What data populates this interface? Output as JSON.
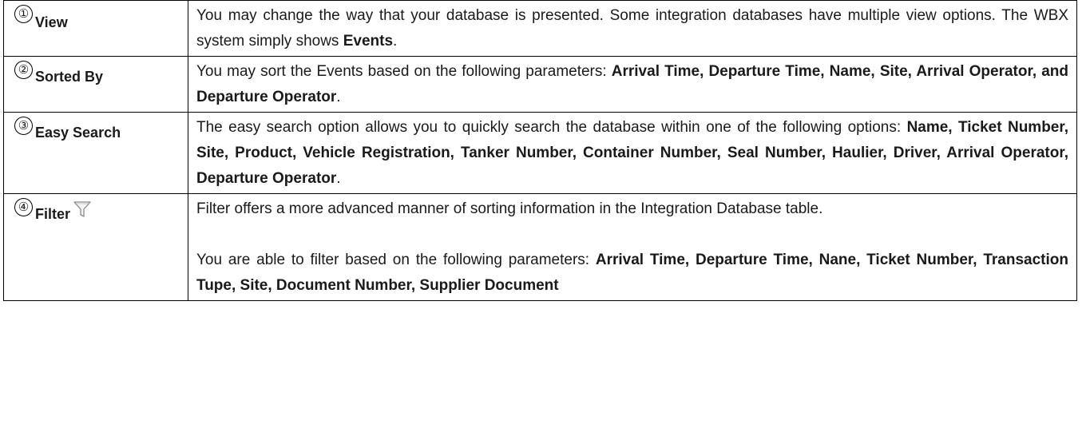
{
  "rows": [
    {
      "number": "①",
      "label": "View",
      "desc": [
        {
          "t": "You may change the way that your database is presented. Some integration databases have multiple view options. The WBX system simply shows ",
          "b": false
        },
        {
          "t": "Events",
          "b": true
        },
        {
          "t": ".",
          "b": false
        }
      ]
    },
    {
      "number": "②",
      "label": "Sorted By",
      "desc": [
        {
          "t": "You may sort the Events based on the following parameters: ",
          "b": false
        },
        {
          "t": "Arrival Time, Departure Time, Name, Site, Arrival Operator, and Departure Operator",
          "b": true
        },
        {
          "t": ".",
          "b": false
        }
      ]
    },
    {
      "number": "③",
      "label": "Easy Search",
      "desc": [
        {
          "t": "The easy search option allows you to quickly search the database within one of the following options: ",
          "b": false
        },
        {
          "t": "Name, Ticket Number, Site, Product, Vehicle Registration, Tanker Number, Container Number, Seal Number, Haulier, Driver, Arrival Operator, Departure Operator",
          "b": true
        },
        {
          "t": ".",
          "b": false
        }
      ]
    },
    {
      "number": "④",
      "label": "Filter",
      "icon": "filter-funnel-icon",
      "desc_p1": [
        {
          "t": "Filter offers a more advanced manner of sorting information in the Integration Database table.",
          "b": false
        }
      ],
      "desc_p2": [
        {
          "t": "You are able to filter based on the following parameters: ",
          "b": false
        },
        {
          "t": "Arrival Time, Departure Time, Nane, Ticket Number, Transaction Tupe, Site, Document Number, Supplier Document",
          "b": true
        }
      ]
    }
  ],
  "colors": {
    "border": "#000000",
    "text": "#1a1a1a",
    "icon_stroke": "#8a8a8a"
  }
}
